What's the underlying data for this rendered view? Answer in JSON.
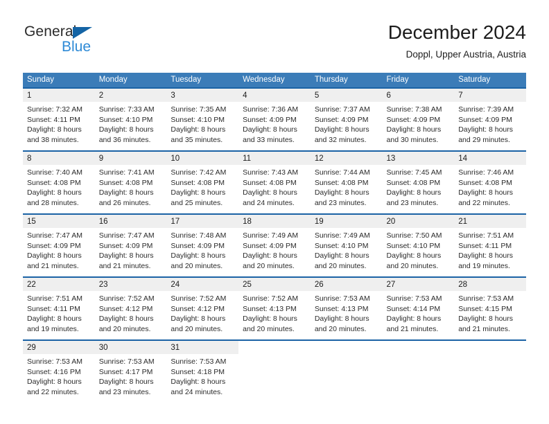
{
  "brand": {
    "name_part1": "General",
    "name_part2": "Blue",
    "triangle_icon": "triangle-icon",
    "accent_dark": "#1464a5",
    "accent_light": "#2e8ad6"
  },
  "header": {
    "title": "December 2024",
    "subtitle": "Doppl, Upper Austria, Austria"
  },
  "theme": {
    "header_blue": "#3b7cb8",
    "row_border_blue": "#1a62a5",
    "daynum_band": "#efefef"
  },
  "weekdays": [
    "Sunday",
    "Monday",
    "Tuesday",
    "Wednesday",
    "Thursday",
    "Friday",
    "Saturday"
  ],
  "weeks": [
    [
      {
        "day": "1",
        "sunrise": "Sunrise: 7:32 AM",
        "sunset": "Sunset: 4:11 PM",
        "daylight1": "Daylight: 8 hours",
        "daylight2": "and 38 minutes."
      },
      {
        "day": "2",
        "sunrise": "Sunrise: 7:33 AM",
        "sunset": "Sunset: 4:10 PM",
        "daylight1": "Daylight: 8 hours",
        "daylight2": "and 36 minutes."
      },
      {
        "day": "3",
        "sunrise": "Sunrise: 7:35 AM",
        "sunset": "Sunset: 4:10 PM",
        "daylight1": "Daylight: 8 hours",
        "daylight2": "and 35 minutes."
      },
      {
        "day": "4",
        "sunrise": "Sunrise: 7:36 AM",
        "sunset": "Sunset: 4:09 PM",
        "daylight1": "Daylight: 8 hours",
        "daylight2": "and 33 minutes."
      },
      {
        "day": "5",
        "sunrise": "Sunrise: 7:37 AM",
        "sunset": "Sunset: 4:09 PM",
        "daylight1": "Daylight: 8 hours",
        "daylight2": "and 32 minutes."
      },
      {
        "day": "6",
        "sunrise": "Sunrise: 7:38 AM",
        "sunset": "Sunset: 4:09 PM",
        "daylight1": "Daylight: 8 hours",
        "daylight2": "and 30 minutes."
      },
      {
        "day": "7",
        "sunrise": "Sunrise: 7:39 AM",
        "sunset": "Sunset: 4:09 PM",
        "daylight1": "Daylight: 8 hours",
        "daylight2": "and 29 minutes."
      }
    ],
    [
      {
        "day": "8",
        "sunrise": "Sunrise: 7:40 AM",
        "sunset": "Sunset: 4:08 PM",
        "daylight1": "Daylight: 8 hours",
        "daylight2": "and 28 minutes."
      },
      {
        "day": "9",
        "sunrise": "Sunrise: 7:41 AM",
        "sunset": "Sunset: 4:08 PM",
        "daylight1": "Daylight: 8 hours",
        "daylight2": "and 26 minutes."
      },
      {
        "day": "10",
        "sunrise": "Sunrise: 7:42 AM",
        "sunset": "Sunset: 4:08 PM",
        "daylight1": "Daylight: 8 hours",
        "daylight2": "and 25 minutes."
      },
      {
        "day": "11",
        "sunrise": "Sunrise: 7:43 AM",
        "sunset": "Sunset: 4:08 PM",
        "daylight1": "Daylight: 8 hours",
        "daylight2": "and 24 minutes."
      },
      {
        "day": "12",
        "sunrise": "Sunrise: 7:44 AM",
        "sunset": "Sunset: 4:08 PM",
        "daylight1": "Daylight: 8 hours",
        "daylight2": "and 23 minutes."
      },
      {
        "day": "13",
        "sunrise": "Sunrise: 7:45 AM",
        "sunset": "Sunset: 4:08 PM",
        "daylight1": "Daylight: 8 hours",
        "daylight2": "and 23 minutes."
      },
      {
        "day": "14",
        "sunrise": "Sunrise: 7:46 AM",
        "sunset": "Sunset: 4:08 PM",
        "daylight1": "Daylight: 8 hours",
        "daylight2": "and 22 minutes."
      }
    ],
    [
      {
        "day": "15",
        "sunrise": "Sunrise: 7:47 AM",
        "sunset": "Sunset: 4:09 PM",
        "daylight1": "Daylight: 8 hours",
        "daylight2": "and 21 minutes."
      },
      {
        "day": "16",
        "sunrise": "Sunrise: 7:47 AM",
        "sunset": "Sunset: 4:09 PM",
        "daylight1": "Daylight: 8 hours",
        "daylight2": "and 21 minutes."
      },
      {
        "day": "17",
        "sunrise": "Sunrise: 7:48 AM",
        "sunset": "Sunset: 4:09 PM",
        "daylight1": "Daylight: 8 hours",
        "daylight2": "and 20 minutes."
      },
      {
        "day": "18",
        "sunrise": "Sunrise: 7:49 AM",
        "sunset": "Sunset: 4:09 PM",
        "daylight1": "Daylight: 8 hours",
        "daylight2": "and 20 minutes."
      },
      {
        "day": "19",
        "sunrise": "Sunrise: 7:49 AM",
        "sunset": "Sunset: 4:10 PM",
        "daylight1": "Daylight: 8 hours",
        "daylight2": "and 20 minutes."
      },
      {
        "day": "20",
        "sunrise": "Sunrise: 7:50 AM",
        "sunset": "Sunset: 4:10 PM",
        "daylight1": "Daylight: 8 hours",
        "daylight2": "and 20 minutes."
      },
      {
        "day": "21",
        "sunrise": "Sunrise: 7:51 AM",
        "sunset": "Sunset: 4:11 PM",
        "daylight1": "Daylight: 8 hours",
        "daylight2": "and 19 minutes."
      }
    ],
    [
      {
        "day": "22",
        "sunrise": "Sunrise: 7:51 AM",
        "sunset": "Sunset: 4:11 PM",
        "daylight1": "Daylight: 8 hours",
        "daylight2": "and 19 minutes."
      },
      {
        "day": "23",
        "sunrise": "Sunrise: 7:52 AM",
        "sunset": "Sunset: 4:12 PM",
        "daylight1": "Daylight: 8 hours",
        "daylight2": "and 20 minutes."
      },
      {
        "day": "24",
        "sunrise": "Sunrise: 7:52 AM",
        "sunset": "Sunset: 4:12 PM",
        "daylight1": "Daylight: 8 hours",
        "daylight2": "and 20 minutes."
      },
      {
        "day": "25",
        "sunrise": "Sunrise: 7:52 AM",
        "sunset": "Sunset: 4:13 PM",
        "daylight1": "Daylight: 8 hours",
        "daylight2": "and 20 minutes."
      },
      {
        "day": "26",
        "sunrise": "Sunrise: 7:53 AM",
        "sunset": "Sunset: 4:13 PM",
        "daylight1": "Daylight: 8 hours",
        "daylight2": "and 20 minutes."
      },
      {
        "day": "27",
        "sunrise": "Sunrise: 7:53 AM",
        "sunset": "Sunset: 4:14 PM",
        "daylight1": "Daylight: 8 hours",
        "daylight2": "and 21 minutes."
      },
      {
        "day": "28",
        "sunrise": "Sunrise: 7:53 AM",
        "sunset": "Sunset: 4:15 PM",
        "daylight1": "Daylight: 8 hours",
        "daylight2": "and 21 minutes."
      }
    ],
    [
      {
        "day": "29",
        "sunrise": "Sunrise: 7:53 AM",
        "sunset": "Sunset: 4:16 PM",
        "daylight1": "Daylight: 8 hours",
        "daylight2": "and 22 minutes."
      },
      {
        "day": "30",
        "sunrise": "Sunrise: 7:53 AM",
        "sunset": "Sunset: 4:17 PM",
        "daylight1": "Daylight: 8 hours",
        "daylight2": "and 23 minutes."
      },
      {
        "day": "31",
        "sunrise": "Sunrise: 7:53 AM",
        "sunset": "Sunset: 4:18 PM",
        "daylight1": "Daylight: 8 hours",
        "daylight2": "and 24 minutes."
      },
      {
        "day": "",
        "sunrise": "",
        "sunset": "",
        "daylight1": "",
        "daylight2": ""
      },
      {
        "day": "",
        "sunrise": "",
        "sunset": "",
        "daylight1": "",
        "daylight2": ""
      },
      {
        "day": "",
        "sunrise": "",
        "sunset": "",
        "daylight1": "",
        "daylight2": ""
      },
      {
        "day": "",
        "sunrise": "",
        "sunset": "",
        "daylight1": "",
        "daylight2": ""
      }
    ]
  ]
}
